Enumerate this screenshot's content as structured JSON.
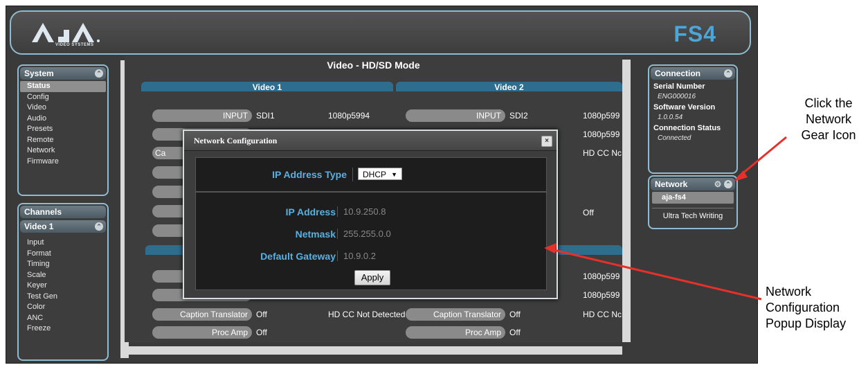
{
  "header": {
    "logo_text": "AJA",
    "logo_sub": "VIDEO SYSTEMS",
    "product": "FS4"
  },
  "system_panel": {
    "title": "System",
    "items": [
      "Status",
      "Config",
      "Video",
      "Audio",
      "Presets",
      "Remote",
      "Network",
      "Firmware"
    ],
    "active": "Status"
  },
  "channels_panel": {
    "title": "Channels",
    "sub_title": "Video 1",
    "items": [
      "Input",
      "Format",
      "Timing",
      "Scale",
      "Keyer",
      "Test Gen",
      "Color",
      "ANC",
      "Freeze"
    ]
  },
  "connection_panel": {
    "title": "Connection",
    "serial_label": "Serial Number",
    "serial_value": "ENG000016",
    "software_label": "Software Version",
    "software_value": "1.0.0.54",
    "status_label": "Connection Status",
    "status_value": "Connected"
  },
  "network_panel": {
    "title": "Network",
    "device": "aja-fs4",
    "entry": "Ultra Tech Writing"
  },
  "content": {
    "title": "Video - HD/SD Mode",
    "video1": {
      "title": "Video 1",
      "input_label": "INPUT",
      "input_value": "SDI1",
      "input_format": "1080p5994",
      "row2_label": "Ca",
      "caption_label": "Caption Translator",
      "caption_value": "Off",
      "caption_status": "HD CC Not Detected",
      "procamp_label": "Proc Amp",
      "procamp_value": "Off"
    },
    "video2": {
      "title": "Video 2",
      "input_label": "INPUT",
      "input_value": "SDI2",
      "input_format": "1080p599",
      "row2_format": "1080p599",
      "row3_status": "HD CC Nc",
      "row5_value": "Off",
      "row8_format": "1080p599",
      "row9_format": "1080p599",
      "caption_label": "Caption Translator",
      "caption_value": "Off",
      "caption_status": "HD CC Nc",
      "procamp_label": "Proc Amp",
      "procamp_value": "Off"
    }
  },
  "modal": {
    "title": "Network Configuration",
    "close": "×",
    "ip_type_label": "IP Address Type",
    "ip_type_value": "DHCP",
    "ip_label": "IP Address",
    "ip_value": "10.9.250.8",
    "netmask_label": "Netmask",
    "netmask_value": "255.255.0.0",
    "gateway_label": "Default Gateway",
    "gateway_value": "10.9.0.2",
    "apply_label": "Apply"
  },
  "annotations": {
    "gear_note": [
      "Click the",
      "Network",
      "Gear Icon"
    ],
    "popup_note": [
      "Network",
      "Configuration",
      "Popup Display"
    ]
  },
  "colors": {
    "accent": "#4aa7da",
    "border": "#8fbcd0",
    "arrow": "#e8302a"
  }
}
